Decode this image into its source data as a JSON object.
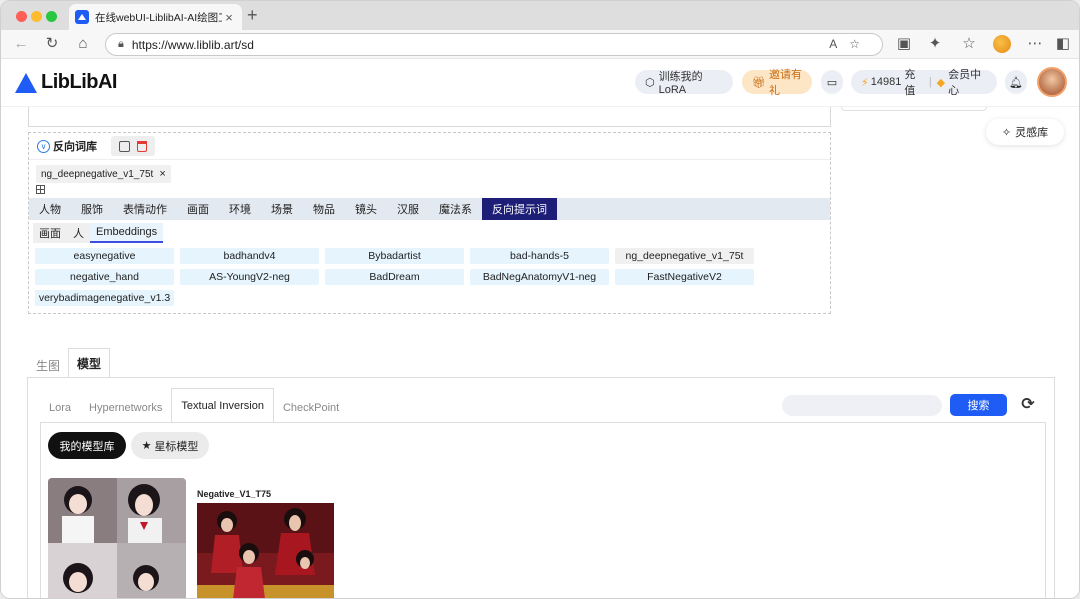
{
  "browser": {
    "tab_title": "在线webUI-LiblibAI-AI绘图工具",
    "url": "https://www.liblib.art/sd",
    "reader_label": "A"
  },
  "header": {
    "logo_text": "LibLibAI",
    "train_lora": "训练我的LoRA",
    "invite": "邀请有礼",
    "credits": "14981",
    "recharge": "充值",
    "member_center": "会员中心"
  },
  "inspiration": "灵感库",
  "negative": {
    "title": "反向词库",
    "selected_chip": "ng_deepnegative_v1_75t",
    "categories": [
      "人物",
      "服饰",
      "表情动作",
      "画面",
      "环境",
      "场景",
      "物品",
      "镜头",
      "汉服",
      "魔法系",
      "反向提示词"
    ],
    "active_category": "反向提示词",
    "subcategories": [
      "画面",
      "人",
      "Embeddings"
    ],
    "active_subcategory": "Embeddings",
    "embeddings": [
      "easynegative",
      "badhandv4",
      "Bybadartist",
      "bad-hands-5",
      "ng_deepnegative_v1_75t",
      "negative_hand",
      "AS-YoungV2-neg",
      "BadDream",
      "BadNegAnatomyV1-neg",
      "FastNegativeV2",
      "verybadimagenegative_v1.3"
    ],
    "selected_embedding": "ng_deepnegative_v1_75t"
  },
  "main_tabs": [
    "生图",
    "模型"
  ],
  "active_main_tab": "模型",
  "model_types": [
    "Lora",
    "Hypernetworks",
    "Textual Inversion",
    "CheckPoint"
  ],
  "active_model_type": "Textual Inversion",
  "search": {
    "placeholder": "",
    "button": "搜索"
  },
  "filters": {
    "my_models": "我的模型库",
    "starred": "星标模型"
  },
  "cards": [
    {
      "title": ""
    },
    {
      "title": "Negative_V1_T75"
    }
  ],
  "colors": {
    "brand_blue": "#1f5cf5",
    "active_category": "#1d1e78",
    "embedding_chip": "#e5f4fd"
  }
}
